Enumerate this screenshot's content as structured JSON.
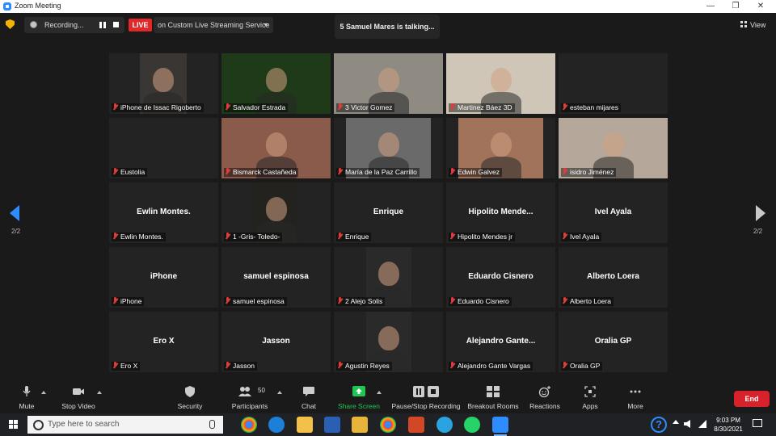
{
  "window": {
    "title": "Zoom Meeting",
    "minimize": "—",
    "maximize": "❐",
    "close": "✕"
  },
  "top": {
    "recording_text": "Recording...",
    "live_badge": "LIVE",
    "live_service": "on Custom Live Streaming Service",
    "talking": "5 Samuel Mares is talking...",
    "view_label": "View"
  },
  "participants": [
    {
      "label": "iPhone de Issac Rigoberto",
      "big": "",
      "video": true,
      "bg": "#3a3633"
    },
    {
      "label": "Salvador Estrada",
      "big": "",
      "video": true,
      "bg": "#1e3a18"
    },
    {
      "label": "3 Victor Gomez",
      "big": "",
      "video": true,
      "bg": "#8f8a82"
    },
    {
      "label": "Martinez Báez  3D",
      "big": "",
      "video": true,
      "bg": "#cfc6b8"
    },
    {
      "label": "esteban mijares",
      "big": "",
      "video": false
    },
    {
      "label": "Eustolia",
      "big": "",
      "video": false
    },
    {
      "label": "Bismarck Castañeda",
      "big": "",
      "video": true,
      "bg": "#8a5a4a"
    },
    {
      "label": "María de la Paz Carrillo",
      "big": "",
      "video": true,
      "bg": "#6a6a6a"
    },
    {
      "label": "Edwin Galvez",
      "big": "",
      "video": true,
      "bg": "#a0735a"
    },
    {
      "label": "isidro  Jiménez",
      "big": "",
      "video": true,
      "bg": "#b5a89a"
    },
    {
      "label": "Ewlin Montes.",
      "big": "Ewlin Montes.",
      "video": false
    },
    {
      "label": "1 -Gris- Toledo-",
      "big": "",
      "video": true,
      "bg": "#23221f"
    },
    {
      "label": "Enrique",
      "big": "Enrique",
      "video": false
    },
    {
      "label": "Hipolito Mendes jr",
      "big": "Hipolito  Mende...",
      "video": false
    },
    {
      "label": "Ivel Ayala",
      "big": "Ivel Ayala",
      "video": false
    },
    {
      "label": "iPhone",
      "big": "iPhone",
      "video": false
    },
    {
      "label": "samuel espinosa",
      "big": "samuel espinosa",
      "video": false
    },
    {
      "label": "2 Alejo Solis",
      "big": "",
      "video": true,
      "bg": "#2a2a2a"
    },
    {
      "label": "Eduardo Cisnero",
      "big": "Eduardo Cisnero",
      "video": false
    },
    {
      "label": "Alberto Loera",
      "big": "Alberto Loera",
      "video": false
    },
    {
      "label": "Ero X",
      "big": "Ero X",
      "video": false
    },
    {
      "label": "Jasson",
      "big": "Jasson",
      "video": false
    },
    {
      "label": "Agustin Reyes",
      "big": "",
      "video": true,
      "bg": "#2a2a2a"
    },
    {
      "label": "Alejandro Gante Vargas",
      "big": "Alejandro  Gante...",
      "video": false
    },
    {
      "label": "Oralia GP",
      "big": "Oralia GP",
      "video": false
    }
  ],
  "nav": {
    "page_left": "2/2",
    "page_right": "2/2"
  },
  "toolbar": {
    "mute": "Mute",
    "stop_video": "Stop Video",
    "security": "Security",
    "participants": "Participants",
    "participants_count": "50",
    "chat": "Chat",
    "share_screen": "Share Screen",
    "pause_stop_recording": "Pause/Stop Recording",
    "breakout_rooms": "Breakout Rooms",
    "reactions": "Reactions",
    "apps": "Apps",
    "more": "More",
    "end": "End"
  },
  "taskbar": {
    "search_placeholder": "Type here to search",
    "time": "9:03 PM",
    "date": "8/30/2021"
  },
  "colors": {
    "accent": "#2d8cff",
    "live": "#e02828",
    "end": "#d8222b",
    "muted": "#e03c3c",
    "share": "#23c552"
  }
}
